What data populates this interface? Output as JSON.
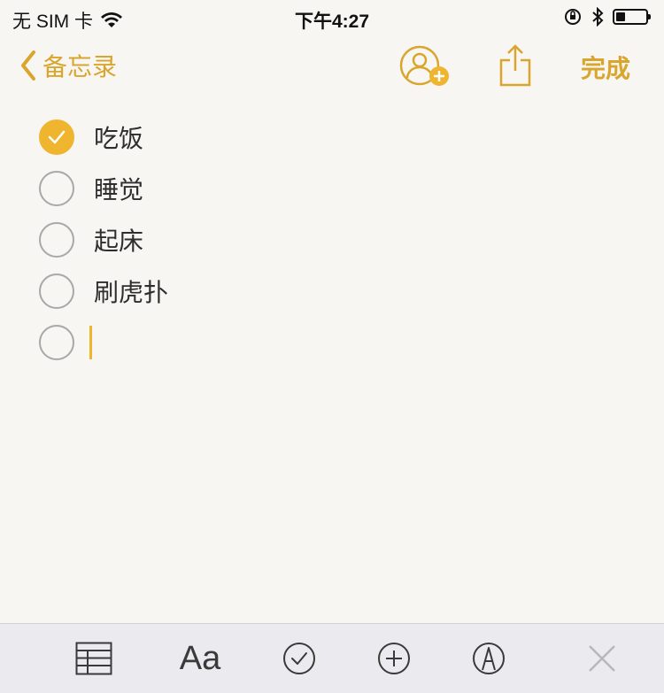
{
  "status_bar": {
    "carrier": "无 SIM 卡",
    "time": "下午4:27",
    "battery_level": 0.3
  },
  "nav": {
    "back_label": "备忘录",
    "done_label": "完成"
  },
  "checklist": [
    {
      "text": "吃饭",
      "checked": true
    },
    {
      "text": "睡觉",
      "checked": false
    },
    {
      "text": "起床",
      "checked": false
    },
    {
      "text": "刷虎扑",
      "checked": false
    },
    {
      "text": "",
      "checked": false
    }
  ],
  "toolbar": {
    "format_label": "Aa",
    "icons": [
      "table-icon",
      "format-icon",
      "checklist-icon",
      "add-icon",
      "markup-icon",
      "close-icon"
    ]
  },
  "colors": {
    "accent": "#d9a52d",
    "check_fill": "#f0b52e",
    "toolbar_bg": "#ebeaee",
    "paper_bg": "#f7f6f3"
  }
}
